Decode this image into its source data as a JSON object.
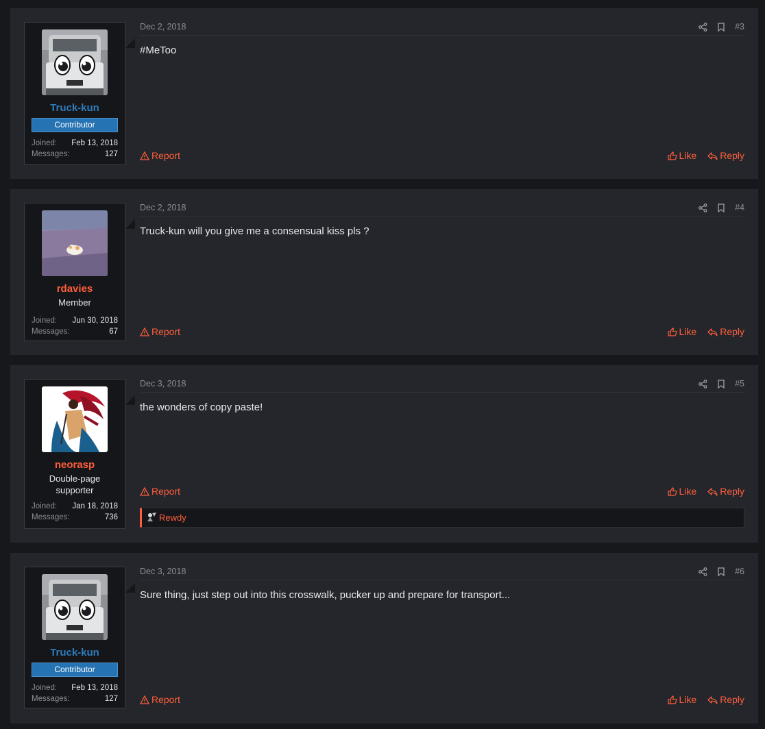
{
  "posts": [
    {
      "number": "#3",
      "date": "Dec 2, 2018",
      "author": "Truck-kun",
      "banner": "Contributor",
      "user_title": "",
      "joined_label": "Joined:",
      "joined": "Feb 13, 2018",
      "messages_label": "Messages:",
      "messages": "127",
      "text": "#MeToo",
      "report_label": "Report",
      "like_label": "Like",
      "reply_label": "Reply",
      "reaction_user": ""
    },
    {
      "number": "#4",
      "date": "Dec 2, 2018",
      "author": "rdavies",
      "banner": "",
      "user_title": "Member",
      "joined_label": "Joined:",
      "joined": "Jun 30, 2018",
      "messages_label": "Messages:",
      "messages": "67",
      "text": "Truck-kun will you give me a consensual kiss pls ?",
      "report_label": "Report",
      "like_label": "Like",
      "reply_label": "Reply",
      "reaction_user": ""
    },
    {
      "number": "#5",
      "date": "Dec 3, 2018",
      "author": "neorasp",
      "banner": "",
      "user_title": "Double-page supporter",
      "joined_label": "Joined:",
      "joined": "Jan 18, 2018",
      "messages_label": "Messages:",
      "messages": "736",
      "text": "the wonders of copy paste!",
      "report_label": "Report",
      "like_label": "Like",
      "reply_label": "Reply",
      "reaction_user": "Rewdy"
    },
    {
      "number": "#6",
      "date": "Dec 3, 2018",
      "author": "Truck-kun",
      "banner": "Contributor",
      "user_title": "",
      "joined_label": "Joined:",
      "joined": "Feb 13, 2018",
      "messages_label": "Messages:",
      "messages": "127",
      "text": "Sure thing, just step out into this crosswalk, pucker up and prepare for transport...",
      "report_label": "Report",
      "like_label": "Like",
      "reply_label": "Reply",
      "reaction_user": ""
    }
  ],
  "icons": {
    "share": "share-icon",
    "bookmark": "bookmark-icon",
    "report": "warning-icon",
    "like": "thumbs-up-icon",
    "reply": "reply-icon"
  },
  "colors": {
    "accent": "#ff5e3a",
    "contributor": "#2e7cbc",
    "banner_bg": "#2673b3"
  }
}
